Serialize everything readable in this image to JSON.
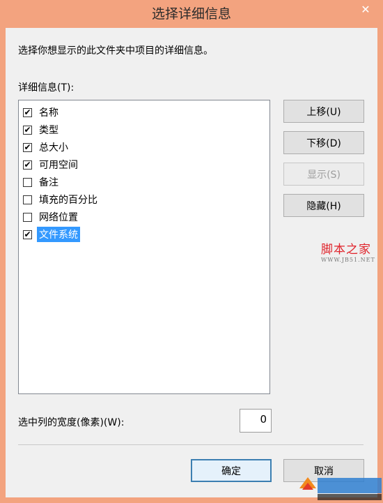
{
  "window": {
    "title": "选择详细信息",
    "close_glyph": "✕"
  },
  "description": "选择你想显示的此文件夹中项目的详细信息。",
  "details_label": "详细信息(T):",
  "items": [
    {
      "label": "名称",
      "checked": true,
      "selected": false
    },
    {
      "label": "类型",
      "checked": true,
      "selected": false
    },
    {
      "label": "总大小",
      "checked": true,
      "selected": false
    },
    {
      "label": "可用空间",
      "checked": true,
      "selected": false
    },
    {
      "label": "备注",
      "checked": false,
      "selected": false
    },
    {
      "label": "填充的百分比",
      "checked": false,
      "selected": false
    },
    {
      "label": "网络位置",
      "checked": false,
      "selected": false
    },
    {
      "label": "文件系统",
      "checked": true,
      "selected": true
    }
  ],
  "buttons": {
    "move_up": "上移(U)",
    "move_down": "下移(D)",
    "show": "显示(S)",
    "hide": "隐藏(H)",
    "ok": "确定",
    "cancel": "取消"
  },
  "column_width": {
    "label": "选中列的宽度(像素)(W):",
    "value": "0"
  },
  "watermark": {
    "title": "脚本之家",
    "url": "WWW.JB51.NET"
  },
  "colors": {
    "frame": "#f3a37f",
    "selection": "#3399ff",
    "watermark": "#e0232b"
  }
}
